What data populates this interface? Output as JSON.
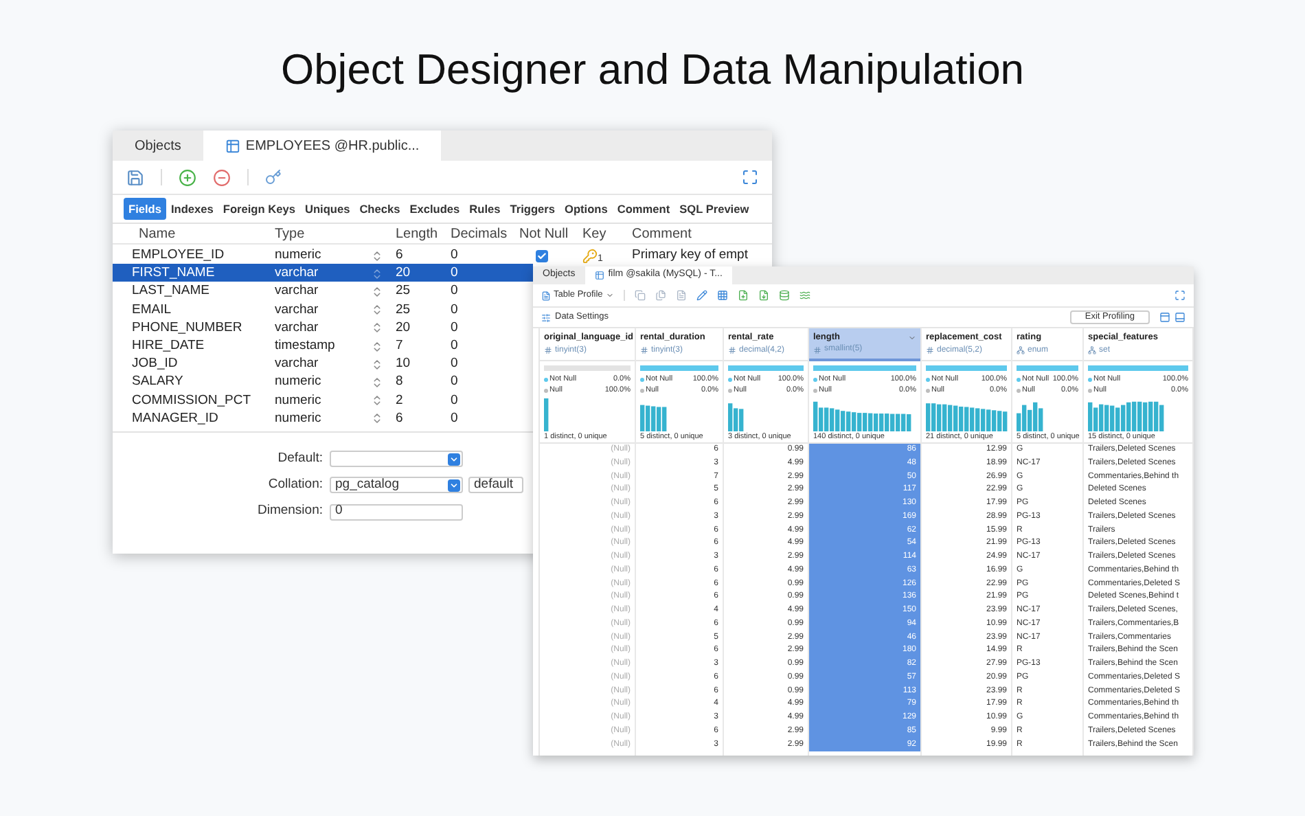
{
  "headline": "Object Designer and Data Manipulation",
  "designer": {
    "tabs": [
      {
        "label": "Objects",
        "selected": false
      },
      {
        "label": "EMPLOYEES @HR.public...",
        "selected": true
      }
    ],
    "subtabs": [
      {
        "label": "Fields",
        "selected": true
      },
      {
        "label": "Indexes",
        "selected": false
      },
      {
        "label": "Foreign Keys",
        "selected": false
      },
      {
        "label": "Uniques",
        "selected": false
      },
      {
        "label": "Checks",
        "selected": false
      },
      {
        "label": "Excludes",
        "selected": false
      },
      {
        "label": "Rules",
        "selected": false
      },
      {
        "label": "Triggers",
        "selected": false
      },
      {
        "label": "Options",
        "selected": false
      },
      {
        "label": "Comment",
        "selected": false
      },
      {
        "label": "SQL Preview",
        "selected": false
      }
    ],
    "columns": [
      "Name",
      "Type",
      "Length",
      "Decimals",
      "Not Null",
      "Key",
      "Comment"
    ],
    "rows": [
      {
        "name": "EMPLOYEE_ID",
        "type": "numeric",
        "length": "6",
        "decimals": "0",
        "selected": false,
        "not_null": true,
        "key": "1",
        "comment": "Primary key of empt"
      },
      {
        "name": "FIRST_NAME",
        "type": "varchar",
        "length": "20",
        "decimals": "0",
        "selected": true
      },
      {
        "name": "LAST_NAME",
        "type": "varchar",
        "length": "25",
        "decimals": "0",
        "selected": false
      },
      {
        "name": "EMAIL",
        "type": "varchar",
        "length": "25",
        "decimals": "0",
        "selected": false
      },
      {
        "name": "PHONE_NUMBER",
        "type": "varchar",
        "length": "20",
        "decimals": "0",
        "selected": false
      },
      {
        "name": "HIRE_DATE",
        "type": "timestamp",
        "length": "7",
        "decimals": "0",
        "selected": false
      },
      {
        "name": "JOB_ID",
        "type": "varchar",
        "length": "10",
        "decimals": "0",
        "selected": false
      },
      {
        "name": "SALARY",
        "type": "numeric",
        "length": "8",
        "decimals": "0",
        "selected": false
      },
      {
        "name": "COMMISSION_PCT",
        "type": "numeric",
        "length": "2",
        "decimals": "0",
        "selected": false
      },
      {
        "name": "MANAGER_ID",
        "type": "numeric",
        "length": "6",
        "decimals": "0",
        "selected": false
      }
    ],
    "form": {
      "default_label": "Default:",
      "collation_label": "Collation:",
      "collation_value": "pg_catalog",
      "collation_extra": "default",
      "dimension_label": "Dimension:",
      "dimension_value": "0"
    }
  },
  "viewer": {
    "tabs": [
      {
        "label": "Objects",
        "selected": false
      },
      {
        "label": "film @sakila (MySQL) - T...",
        "selected": true
      }
    ],
    "profile_button": "Table Profile",
    "data_settings": "Data Settings",
    "exit_button": "Exit Profiling",
    "columns": [
      {
        "name": "original_language_id",
        "type": "tinyint(3)",
        "kind": "number",
        "selected": false,
        "level": 0,
        "not_null_label": "Not Null",
        "not_null_pct": "0.0%",
        "null_label": "Null",
        "null_pct": "100.0%",
        "distinct": "1 distinct, 0 unique"
      },
      {
        "name": "rental_duration",
        "type": "tinyint(3)",
        "kind": "number",
        "selected": false,
        "level": 1,
        "not_null_label": "Not Null",
        "not_null_pct": "100.0%",
        "null_label": "Null",
        "null_pct": "0.0%",
        "distinct": "5 distinct, 0 unique"
      },
      {
        "name": "rental_rate",
        "type": "decimal(4,2)",
        "kind": "number",
        "selected": false,
        "level": 1,
        "not_null_label": "Not Null",
        "not_null_pct": "100.0%",
        "null_label": "Null",
        "null_pct": "0.0%",
        "distinct": "3 distinct, 0 unique"
      },
      {
        "name": "length",
        "type": "smallint(5)",
        "kind": "number",
        "selected": true,
        "level": 1,
        "not_null_label": "Not Null",
        "not_null_pct": "100.0%",
        "null_label": "Null",
        "null_pct": "0.0%",
        "distinct": "140 distinct, 0 unique"
      },
      {
        "name": "replacement_cost",
        "type": "decimal(5,2)",
        "kind": "number",
        "selected": false,
        "level": 1,
        "not_null_label": "Not Null",
        "not_null_pct": "100.0%",
        "null_label": "Null",
        "null_pct": "0.0%",
        "distinct": "21 distinct, 0 unique"
      },
      {
        "name": "rating",
        "type": "enum",
        "kind": "enum",
        "selected": false,
        "level": 1,
        "not_null_label": "Not Null",
        "not_null_pct": "100.0%",
        "null_label": "Null",
        "null_pct": "0.0%",
        "distinct": "5 distinct, 0 unique"
      },
      {
        "name": "special_features",
        "type": "set",
        "kind": "enum",
        "selected": false,
        "level": 1,
        "not_null_label": "Not Null",
        "not_null_pct": "100.0%",
        "null_label": "Null",
        "null_pct": "0.0%",
        "distinct": "15 distinct, 0 unique"
      }
    ],
    "rows": [
      [
        "(Null)",
        "6",
        "0.99",
        "86",
        "12.99",
        "G",
        "Trailers,Deleted Scenes"
      ],
      [
        "(Null)",
        "3",
        "4.99",
        "48",
        "18.99",
        "NC-17",
        "Trailers,Deleted Scenes"
      ],
      [
        "(Null)",
        "7",
        "2.99",
        "50",
        "26.99",
        "G",
        "Commentaries,Behind th"
      ],
      [
        "(Null)",
        "5",
        "2.99",
        "117",
        "22.99",
        "G",
        "Deleted Scenes"
      ],
      [
        "(Null)",
        "6",
        "2.99",
        "130",
        "17.99",
        "PG",
        "Deleted Scenes"
      ],
      [
        "(Null)",
        "3",
        "2.99",
        "169",
        "28.99",
        "PG-13",
        "Trailers,Deleted Scenes"
      ],
      [
        "(Null)",
        "6",
        "4.99",
        "62",
        "15.99",
        "R",
        "Trailers"
      ],
      [
        "(Null)",
        "6",
        "4.99",
        "54",
        "21.99",
        "PG-13",
        "Trailers,Deleted Scenes"
      ],
      [
        "(Null)",
        "3",
        "2.99",
        "114",
        "24.99",
        "NC-17",
        "Trailers,Deleted Scenes"
      ],
      [
        "(Null)",
        "6",
        "4.99",
        "63",
        "16.99",
        "G",
        "Commentaries,Behind th"
      ],
      [
        "(Null)",
        "6",
        "0.99",
        "126",
        "22.99",
        "PG",
        "Commentaries,Deleted S"
      ],
      [
        "(Null)",
        "6",
        "0.99",
        "136",
        "21.99",
        "PG",
        "Deleted Scenes,Behind t"
      ],
      [
        "(Null)",
        "4",
        "4.99",
        "150",
        "23.99",
        "NC-17",
        "Trailers,Deleted Scenes,"
      ],
      [
        "(Null)",
        "6",
        "0.99",
        "94",
        "10.99",
        "NC-17",
        "Trailers,Commentaries,B"
      ],
      [
        "(Null)",
        "5",
        "2.99",
        "46",
        "23.99",
        "NC-17",
        "Trailers,Commentaries"
      ],
      [
        "(Null)",
        "6",
        "2.99",
        "180",
        "14.99",
        "R",
        "Trailers,Behind the Scen"
      ],
      [
        "(Null)",
        "3",
        "0.99",
        "82",
        "27.99",
        "PG-13",
        "Trailers,Behind the Scen"
      ],
      [
        "(Null)",
        "6",
        "0.99",
        "57",
        "20.99",
        "PG",
        "Commentaries,Deleted S"
      ],
      [
        "(Null)",
        "6",
        "0.99",
        "113",
        "23.99",
        "R",
        "Commentaries,Deleted S"
      ],
      [
        "(Null)",
        "4",
        "4.99",
        "79",
        "17.99",
        "R",
        "Commentaries,Behind th"
      ],
      [
        "(Null)",
        "3",
        "4.99",
        "129",
        "10.99",
        "G",
        "Commentaries,Behind th"
      ],
      [
        "(Null)",
        "6",
        "2.99",
        "85",
        "9.99",
        "R",
        "Trailers,Deleted Scenes"
      ],
      [
        "(Null)",
        "3",
        "2.99",
        "92",
        "19.99",
        "R",
        "Trailers,Behind the Scen"
      ]
    ]
  }
}
